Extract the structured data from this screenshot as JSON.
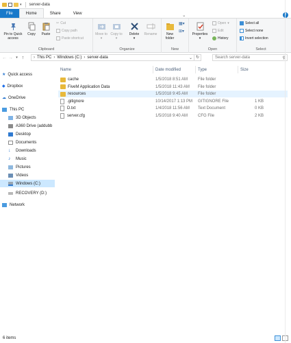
{
  "window": {
    "title": "server-data"
  },
  "tabs": [
    {
      "label": "File"
    },
    {
      "label": "Home"
    },
    {
      "label": "Share"
    },
    {
      "label": "View"
    }
  ],
  "ribbon": {
    "clipboard": {
      "label": "Clipboard",
      "pin": "Pin to Quick access",
      "copy": "Copy",
      "paste": "Paste",
      "cut": "Cut",
      "copy_path": "Copy path",
      "paste_shortcut": "Paste shortcut"
    },
    "organize": {
      "label": "Organize",
      "move_to": "Move to",
      "copy_to": "Copy to",
      "delete": "Delete",
      "rename": "Rename"
    },
    "new": {
      "label": "New",
      "new_folder": "New folder"
    },
    "open": {
      "label": "Open",
      "properties": "Properties",
      "open": "Open",
      "edit": "Edit",
      "history": "History"
    },
    "select": {
      "label": "Select",
      "select_all": "Select all",
      "select_none": "Select none",
      "invert": "Invert selection"
    }
  },
  "address": {
    "crumbs": [
      "This PC",
      "Windows (C:)",
      "server-data"
    ],
    "search_placeholder": "Search server-data"
  },
  "nav": {
    "quick_access": "Quick access",
    "dropbox": "Dropbox",
    "onedrive": "OneDrive",
    "this_pc": "This PC",
    "items": [
      "3D Objects",
      "A360 Drive (addubb",
      "Desktop",
      "Documents",
      "Downloads",
      "Music",
      "Pictures",
      "Videos",
      "Windows (C:)",
      "RECOVERY (D:)"
    ],
    "network": "Network"
  },
  "columns": {
    "name": "Name",
    "date": "Date modified",
    "type": "Type",
    "size": "Size"
  },
  "files": [
    {
      "name": "cache",
      "date": "1/5/2018 8:51 AM",
      "type": "File folder",
      "size": "",
      "kind": "folder"
    },
    {
      "name": "FiveM Application Data",
      "date": "1/5/2018 11:43 AM",
      "type": "File folder",
      "size": "",
      "kind": "folder"
    },
    {
      "name": "resources",
      "date": "1/5/2018 9:45 AM",
      "type": "File folder",
      "size": "",
      "kind": "folder"
    },
    {
      "name": ".gitignore",
      "date": "10/14/2017 1:13 PM",
      "type": "GITIGNORE File",
      "size": "1 KB",
      "kind": "file"
    },
    {
      "name": "D.txt",
      "date": "1/4/2018 11:56 AM",
      "type": "Text Document",
      "size": "0 KB",
      "kind": "file"
    },
    {
      "name": "server.cfg",
      "date": "1/5/2018 9:40 AM",
      "type": "CFG File",
      "size": "2 KB",
      "kind": "file"
    }
  ],
  "status": {
    "count": "6 items"
  },
  "colors": {
    "accent": "#1979ca",
    "folder": "#e8b93b",
    "selection": "#cce8ff",
    "hover": "#e5f3ff"
  }
}
